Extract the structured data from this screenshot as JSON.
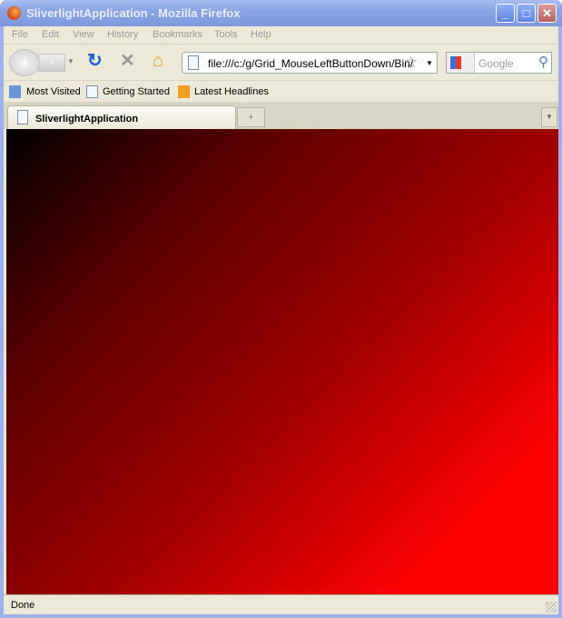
{
  "window": {
    "title": "SliverlightApplication - Mozilla Firefox"
  },
  "menu": [
    "File",
    "Edit",
    "View",
    "History",
    "Bookmarks",
    "Tools",
    "Help"
  ],
  "toolbar": {
    "url": "file:///c:/g/Grid_MouseLeftButtonDown/Bin/",
    "search_placeholder": "Google"
  },
  "bookmarks": [
    "Most Visited",
    "Getting Started",
    "Latest Headlines"
  ],
  "tabs": [
    {
      "label": "SliverlightApplication"
    }
  ],
  "status": {
    "text": "Done"
  },
  "colors": {
    "gradient_start": "#000000",
    "gradient_end": "#ff0000"
  }
}
